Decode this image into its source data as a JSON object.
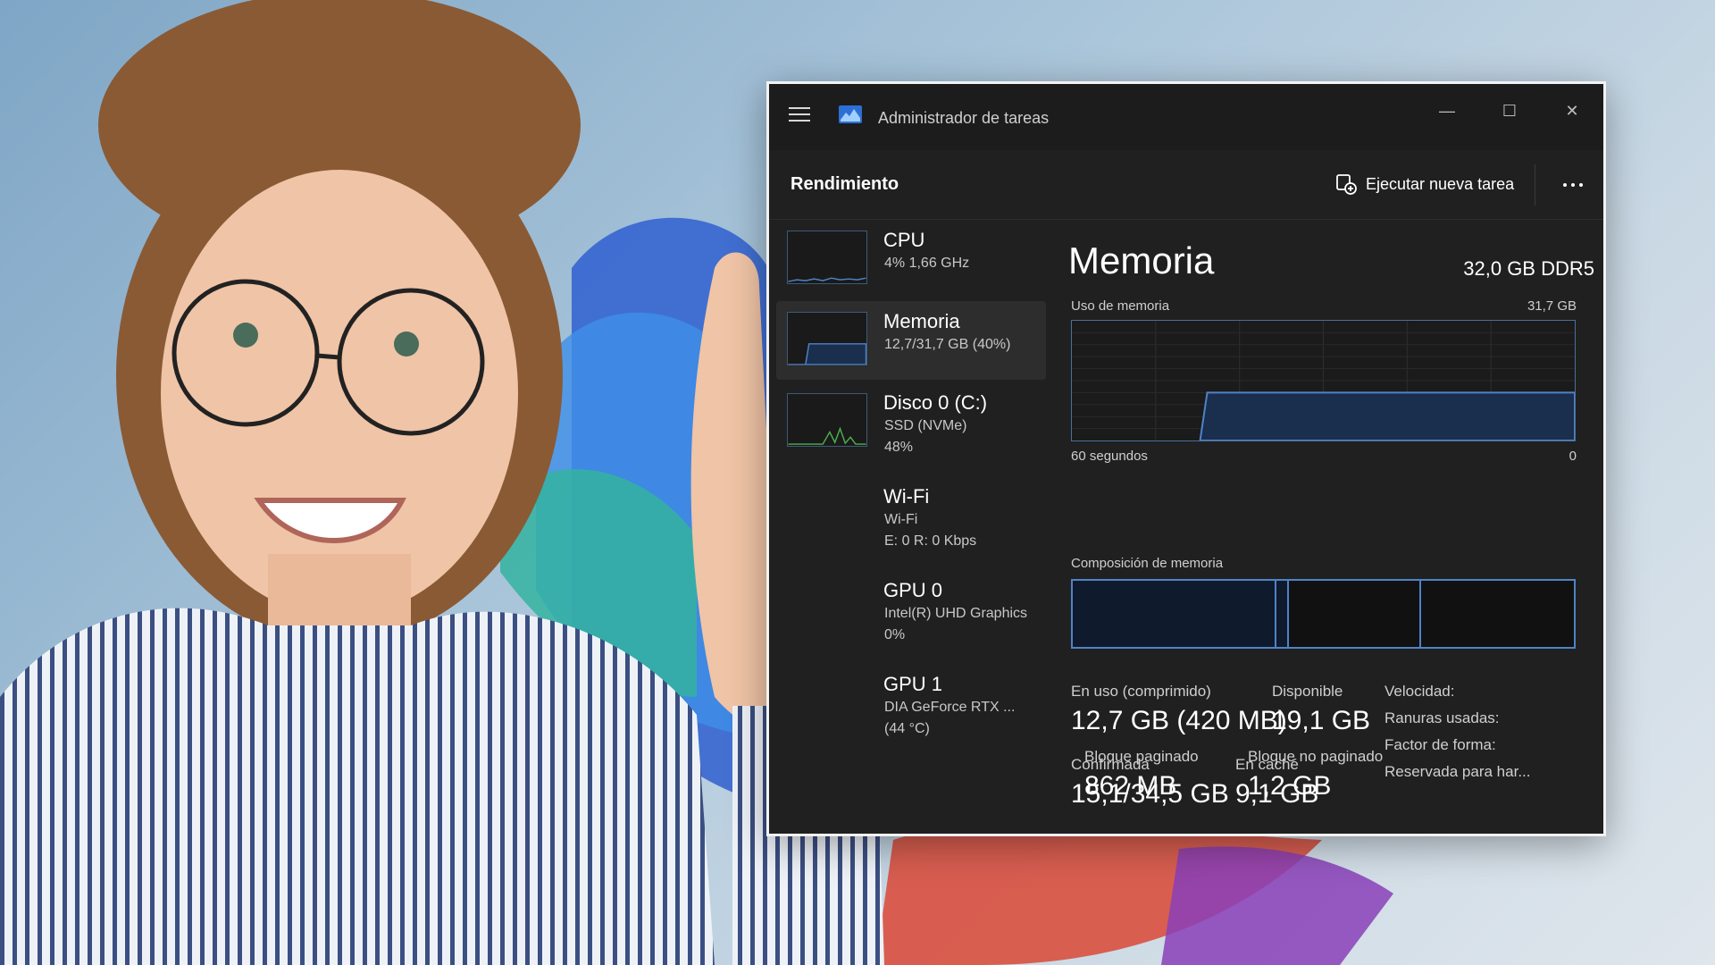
{
  "window": {
    "title": "Administrador de tareas",
    "min_icon": "minimize-icon",
    "max_icon": "maximize-icon",
    "close_icon": "close-icon"
  },
  "toolbar": {
    "section": "Rendimiento",
    "run_task": "Ejecutar nueva tarea"
  },
  "sidebar": {
    "items": [
      {
        "name": "CPU",
        "sub": "4%  1,66 GHz",
        "sub2": ""
      },
      {
        "name": "Memoria",
        "sub": "12,7/31,7 GB (40%)",
        "sub2": ""
      },
      {
        "name": "Disco 0 (C:)",
        "sub": "SSD (NVMe)",
        "sub2": "48%"
      },
      {
        "name": "Wi-Fi",
        "sub": "Wi-Fi",
        "sub2": "E: 0  R: 0 Kbps"
      },
      {
        "name": "GPU 0",
        "sub": "Intel(R) UHD Graphics",
        "sub2": "0%"
      },
      {
        "name": "GPU 1",
        "sub": "DIA GeForce RTX ...",
        "sub2": "(44 °C)"
      }
    ]
  },
  "memory": {
    "title": "Memoria",
    "spec": "32,0 GB DDR5",
    "usage_label": "Uso de memoria",
    "usage_max": "31,7 GB",
    "time_left": "60 segundos",
    "time_right": "0",
    "composition_label": "Composición de memoria",
    "usage_level_fraction": 0.4,
    "stats": {
      "in_use_label": "En uso (comprimido)",
      "in_use_value": "12,7 GB (420 MB)",
      "available_label": "Disponible",
      "available_value": "19,1 GB",
      "committed_label": "Confirmada",
      "committed_value": "15,1/34,5 GB",
      "cached_label": "En caché",
      "cached_value": "9,1 GB",
      "paged_label": "Bloque paginado",
      "paged_value": "862 MB",
      "nonpaged_label": "Bloque no paginado",
      "nonpaged_value": "1,2 GB"
    },
    "right_labels": {
      "speed": "Velocidad:",
      "slots": "Ranuras usadas:",
      "form": "Factor de forma:",
      "reserved": "Reservada para har..."
    }
  },
  "colors": {
    "graph_line": "#4f83c7",
    "graph_fill": "#1a2e4d",
    "window_bg": "#202020"
  }
}
